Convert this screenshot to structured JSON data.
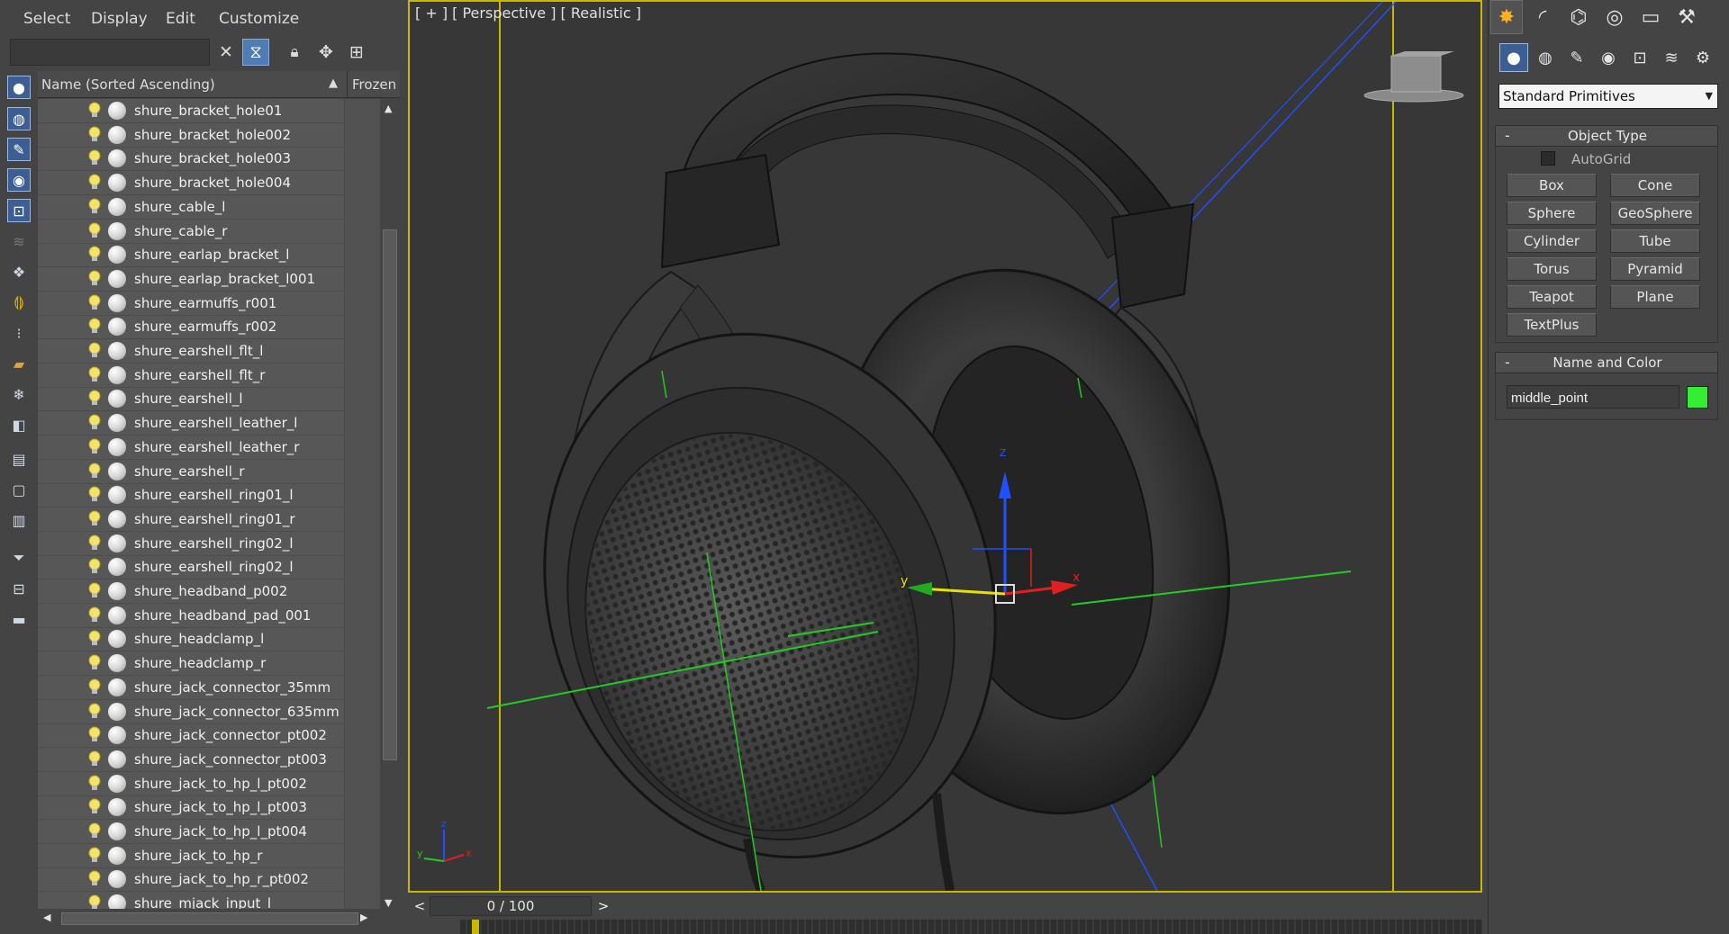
{
  "explorer": {
    "menu": [
      "Select",
      "Display",
      "Edit",
      "Customize"
    ],
    "search_value": "",
    "toolbar_icons": [
      "clear-icon",
      "filter-icon",
      "lock-icon",
      "select-children-icon",
      "select-dependents-icon"
    ],
    "header": {
      "name_column": "Name (Sorted Ascending)",
      "sort_indicator": "▲",
      "frozen_column": "Frozen"
    },
    "items": [
      "shure_bracket_hole01",
      "shure_bracket_hole002",
      "shure_bracket_hole003",
      "shure_bracket_hole004",
      "shure_cable_l",
      "shure_cable_r",
      "shure_earlap_bracket_l",
      "shure_earlap_bracket_l001",
      "shure_earmuffs_r001",
      "shure_earmuffs_r002",
      "shure_earshell_flt_l",
      "shure_earshell_flt_r",
      "shure_earshell_l",
      "shure_earshell_leather_l",
      "shure_earshell_leather_r",
      "shure_earshell_r",
      "shure_earshell_ring01_l",
      "shure_earshell_ring01_r",
      "shure_earshell_ring02_l",
      "shure_earshell_ring02_l",
      "shure_headband_p002",
      "shure_headband_pad_001",
      "shure_headclamp_l",
      "shure_headclamp_r",
      "shure_jack_connector_35mm",
      "shure_jack_connector_635mm",
      "shure_jack_connector_pt002",
      "shure_jack_connector_pt003",
      "shure_jack_to_hp_l_pt002",
      "shure_jack_to_hp_l_pt003",
      "shure_jack_to_hp_l_pt004",
      "shure_jack_to_hp_r",
      "shure_jack_to_hp_r_pt002",
      "shure_mjack_input_l"
    ]
  },
  "viewport": {
    "label": "[ + ] [ Perspective ] [ Realistic ]",
    "gizmo_axes": {
      "x": "x",
      "y": "y",
      "z": "z"
    },
    "corner_axes": {
      "x": "x",
      "y": "y",
      "z": "z"
    }
  },
  "timeline": {
    "frame_display": "0 / 100",
    "back": "<",
    "forward": ">"
  },
  "command_panel": {
    "dropdown_value": "Standard Primitives",
    "object_type": {
      "title": "Object Type",
      "collapse": "-",
      "autogrid_label": "AutoGrid",
      "autogrid_checked": false,
      "buttons": [
        "Box",
        "Cone",
        "Sphere",
        "GeoSphere",
        "Cylinder",
        "Tube",
        "Torus",
        "Pyramid",
        "Teapot",
        "Plane",
        "TextPlus"
      ]
    },
    "name_and_color": {
      "title": "Name and Color",
      "collapse": "-",
      "name_value": "middle_point",
      "color": "#33ee33"
    }
  },
  "colors": {
    "accent_blue": "#3b5f93",
    "viewport_border": "#c9b800",
    "axis_x": "#e02020",
    "axis_y": "#e8e000",
    "axis_z": "#2050ff",
    "grid_green": "#22cc22"
  }
}
